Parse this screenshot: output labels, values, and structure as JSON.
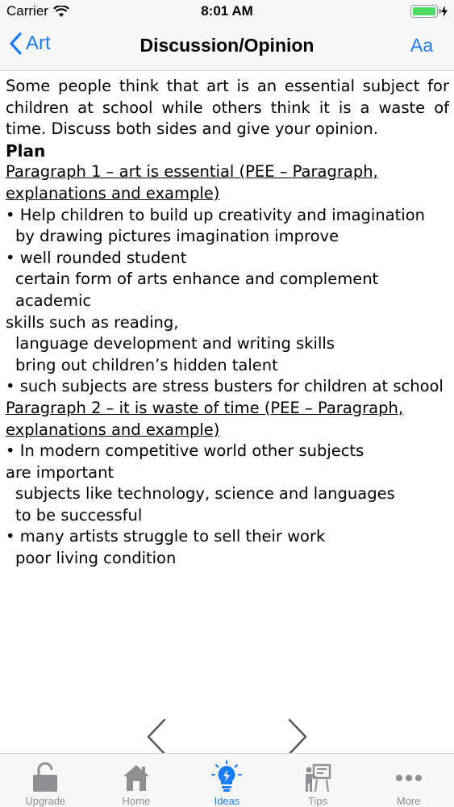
{
  "status_bar": {
    "carrier": "Carrier",
    "time": "8:01 AM",
    "battery_level": 1.0
  },
  "nav": {
    "back_label": "Art",
    "title": "Discussion/Opinion",
    "font_button": "Aa"
  },
  "content": {
    "prompt": "Some people think that art is an essential subject for children at school while others think it is a waste of time. Discuss both sides and give your opinion.",
    "plan_heading": "Plan",
    "sections": [
      {
        "heading": "Paragraph 1 – art is essential  (PEE – Paragraph, explanations and example)",
        "lines": [
          {
            "text": "• Help children to build up creativity and imagination",
            "indent": false
          },
          {
            "text": "by drawing pictures imagination improve",
            "indent": true
          },
          {
            "text": "• well rounded student",
            "indent": false
          },
          {
            "text": "certain form of arts enhance and complement academic",
            "indent": true
          },
          {
            "text": "skills such as reading,",
            "indent": false
          },
          {
            "text": "language development and writing skills",
            "indent": true
          },
          {
            "text": "bring out children’s hidden talent",
            "indent": true
          },
          {
            "text": "• such subjects are stress busters for children at school",
            "indent": false
          }
        ]
      },
      {
        "heading": "Paragraph 2 – it is waste of time  (PEE – Paragraph, explanations and example)",
        "lines": [
          {
            "text": "• In modern competitive world other subjects",
            "indent": false
          },
          {
            "text": "are important",
            "indent": false
          },
          {
            "text": "subjects like technology, science and languages",
            "indent": true
          },
          {
            "text": "to be successful",
            "indent": true
          },
          {
            "text": "• many artists struggle to sell their work",
            "indent": false
          },
          {
            "text": "poor living condition",
            "indent": true
          }
        ]
      }
    ]
  },
  "pager": {
    "prev_icon": "chevron-left-icon",
    "next_icon": "chevron-right-icon"
  },
  "tabs": [
    {
      "label": "Upgrade",
      "icon": "lock-icon",
      "active": false
    },
    {
      "label": "Home",
      "icon": "house-icon",
      "active": false
    },
    {
      "label": "Ideas",
      "icon": "lightbulb-icon",
      "active": true
    },
    {
      "label": "Tips",
      "icon": "teacher-board-icon",
      "active": false
    },
    {
      "label": "More",
      "icon": "more-dots-icon",
      "active": false
    }
  ],
  "colors": {
    "accent": "#1a7cf5",
    "inactive": "#8e8e93",
    "battery": "#4cd964"
  }
}
